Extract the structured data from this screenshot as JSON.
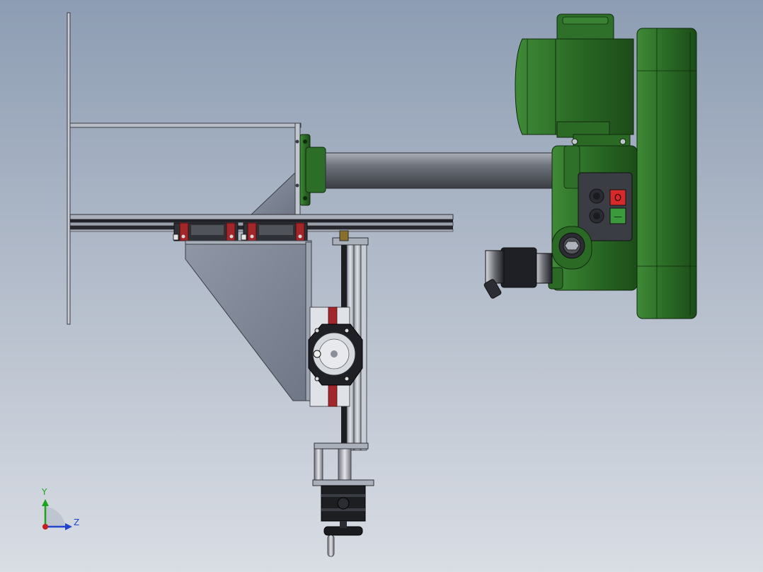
{
  "app": {
    "title": ""
  },
  "viewport": {
    "background_top": "#8d9db3",
    "background_bottom": "#d9dde4"
  },
  "colors": {
    "motor_green": "#2a6a25",
    "motor_green_dark": "#173f14",
    "steel_light": "#aeb4bf",
    "steel_mid": "#7e8594",
    "steel_dark": "#2b2d33",
    "carriage_red": "#a3262b",
    "start_button": "#3b9b3c",
    "stop_button": "#d62a2a"
  },
  "triad": {
    "y_label": "Y",
    "z_label": "Z",
    "y_color": "#1fa31f",
    "z_color": "#2244cc",
    "origin_color": "#c41e1e"
  },
  "control_box": {
    "start_symbol": "—",
    "stop_symbol": "O"
  }
}
